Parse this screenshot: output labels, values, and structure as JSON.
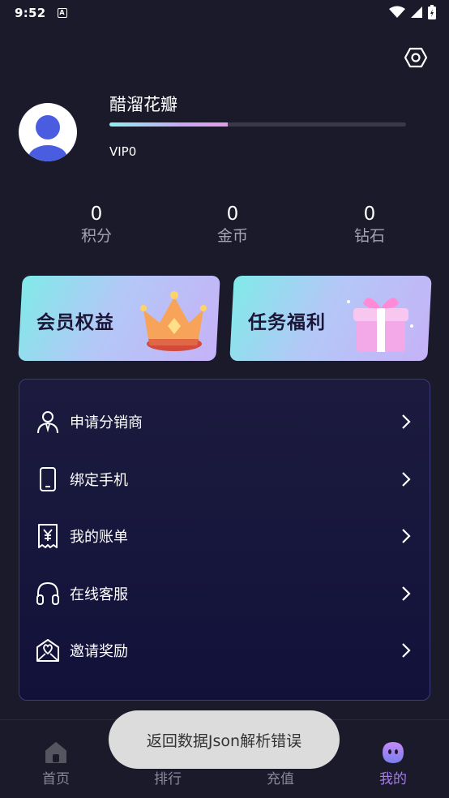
{
  "status_bar": {
    "time": "9:52",
    "notification_glyph": "A"
  },
  "profile": {
    "username": "醋溜花瓣",
    "vip_level": "VIP0",
    "level_progress": 0.4
  },
  "stats": [
    {
      "value": "0",
      "label": "积分"
    },
    {
      "value": "0",
      "label": "金币"
    },
    {
      "value": "0",
      "label": "钻石"
    }
  ],
  "promos": [
    {
      "title": "会员权益",
      "icon": "crown-icon"
    },
    {
      "title": "任务福利",
      "icon": "gift-box-icon"
    }
  ],
  "menu": [
    {
      "label": "申请分销商",
      "icon": "person-tie-icon"
    },
    {
      "label": "绑定手机",
      "icon": "phone-icon"
    },
    {
      "label": "我的账单",
      "icon": "receipt-yen-icon"
    },
    {
      "label": "在线客服",
      "icon": "headset-icon"
    },
    {
      "label": "邀请奖励",
      "icon": "heart-envelope-icon"
    }
  ],
  "nav": [
    {
      "label": "首页",
      "icon": "home-icon",
      "active": false
    },
    {
      "label": "排行",
      "icon": "ranking-icon",
      "active": false
    },
    {
      "label": "充值",
      "icon": "recharge-icon",
      "active": false
    },
    {
      "label": "我的",
      "icon": "ghost-face-icon",
      "active": true
    }
  ],
  "toast": {
    "message": "返回数据Json解析错误"
  },
  "colors": {
    "background": "#1b1a2b",
    "accent": "#a57bf0",
    "panel_border": "#3b3a7a"
  }
}
